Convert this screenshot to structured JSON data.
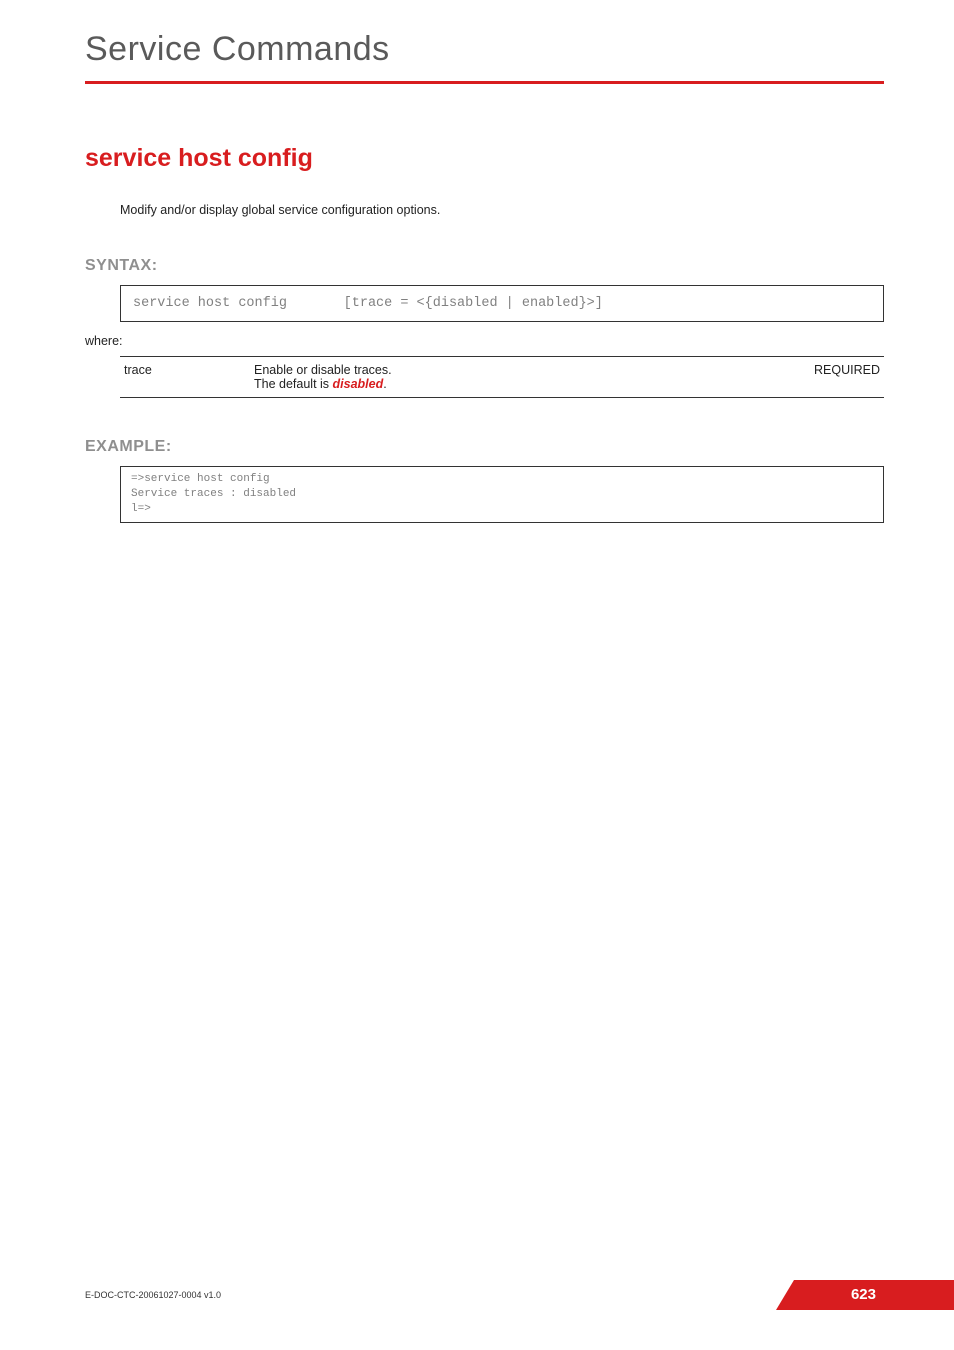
{
  "chapter": "Service Commands",
  "section_title": "service host config",
  "intro": "Modify and/or display global  service configuration options.",
  "syntax_heading": "SYNTAX:",
  "syntax_line": "service host config       [trace = <{disabled | enabled}>]",
  "where_label": "where:",
  "param": {
    "name": "trace",
    "desc_line1": "Enable or disable traces.",
    "desc_line2_prefix": "The default is ",
    "desc_line2_value": "disabled",
    "desc_line2_suffix": ".",
    "req": "REQUIRED"
  },
  "example_heading": "EXAMPLE:",
  "example_block": "=>service host config\nService traces : disabled\nl=>",
  "footer": {
    "doc_id": "E-DOC-CTC-20061027-0004 v1.0",
    "page_number": "623"
  }
}
